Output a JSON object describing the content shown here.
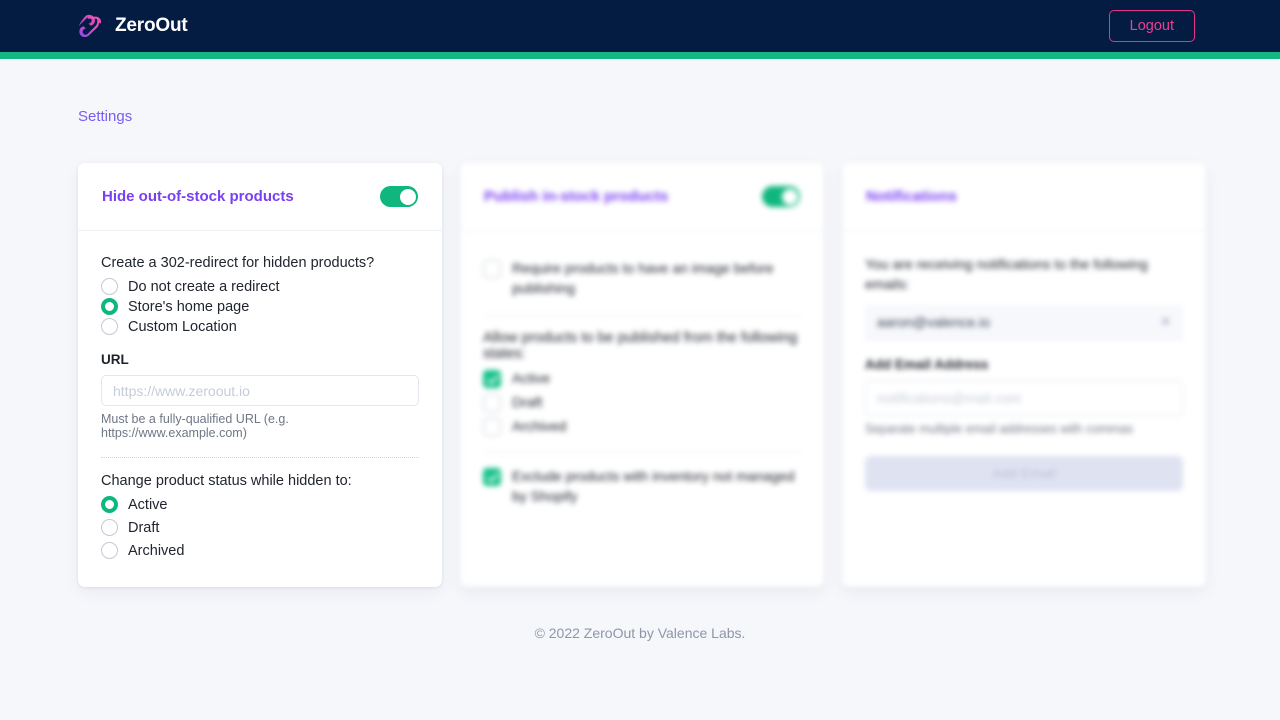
{
  "navbar": {
    "brand_name": "ZeroOut",
    "logo_icon": "zeroout-logo-icon",
    "logout_label": "Logout",
    "bg_color": "#041c42",
    "accent_color": "#14b683",
    "logout_color": "#ef3e96"
  },
  "breadcrumb": {
    "label": "Settings",
    "color": "#7b5cf0"
  },
  "cards": {
    "hide_out_of_stock": {
      "title": "Hide out-of-stock products",
      "toggle_on": true,
      "redirect_question": "Create a 302-redirect for hidden products?",
      "redirect_options": [
        {
          "label": "Do not create a redirect",
          "selected": false
        },
        {
          "label": "Store's home page",
          "selected": true
        },
        {
          "label": "Custom Location",
          "selected": false
        }
      ],
      "url_label": "URL",
      "url_value": "",
      "url_placeholder": "https://www.zeroout.io",
      "url_help": "Must be a fully-qualified URL (e.g. https://www.example.com)",
      "status_question": "Change product status while hidden to:",
      "status_options": [
        {
          "label": "Active",
          "selected": true
        },
        {
          "label": "Draft",
          "selected": false
        },
        {
          "label": "Archived",
          "selected": false
        }
      ]
    },
    "publish_in_stock": {
      "title": "Publish in-stock products",
      "toggle_on": true,
      "require_image_label": "Require products to have an image before publishing",
      "require_image_checked": false,
      "states_question": "Allow products to be published from the following states:",
      "state_options": [
        {
          "label": "Active",
          "checked": true
        },
        {
          "label": "Draft",
          "checked": false
        },
        {
          "label": "Archived",
          "checked": false
        }
      ],
      "exclude_label": "Exclude products with inventory not managed by Shopify",
      "exclude_checked": true
    },
    "notifications": {
      "title": "Notifications",
      "receiving_text": "You are receiving notifications to the following emails:",
      "emails": [
        {
          "address": "aaron@valence.io",
          "remove_icon": "close-icon"
        }
      ],
      "add_email_label": "Add Email Address",
      "add_email_value": "",
      "add_email_placeholder": "notifications@mail.com",
      "add_email_help": "Separate multiple email addresses with commas",
      "add_email_button": "Add Email"
    }
  },
  "footer": {
    "text": "© 2022 ZeroOut by Valence Labs."
  }
}
